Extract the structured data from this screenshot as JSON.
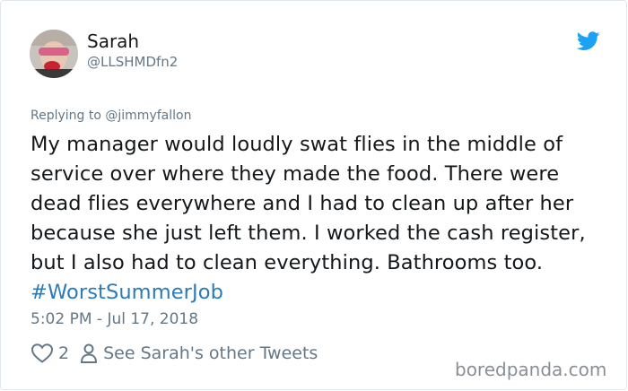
{
  "user": {
    "display_name": "Sarah",
    "handle": "@LLSHMDfn2"
  },
  "reply": {
    "prefix": "Replying to ",
    "mention": "@jimmyfallon"
  },
  "tweet": {
    "body_text": "My manager would loudly swat flies in the middle of service over where they made the food. There were dead flies everywhere and I had to clean up after her because she just left them. I worked the cash register, but I also had to clean everything. Bathrooms too. ",
    "hashtag": "#WorstSummerJob",
    "timestamp": "5:02 PM - Jul 17, 2018"
  },
  "actions": {
    "like_count": "2",
    "profile_link": "See Sarah's other Tweets"
  },
  "watermark": "boredpanda.com",
  "colors": {
    "link": "#2b7bb9",
    "twitter_blue": "#1da1f2",
    "muted": "#657786"
  }
}
